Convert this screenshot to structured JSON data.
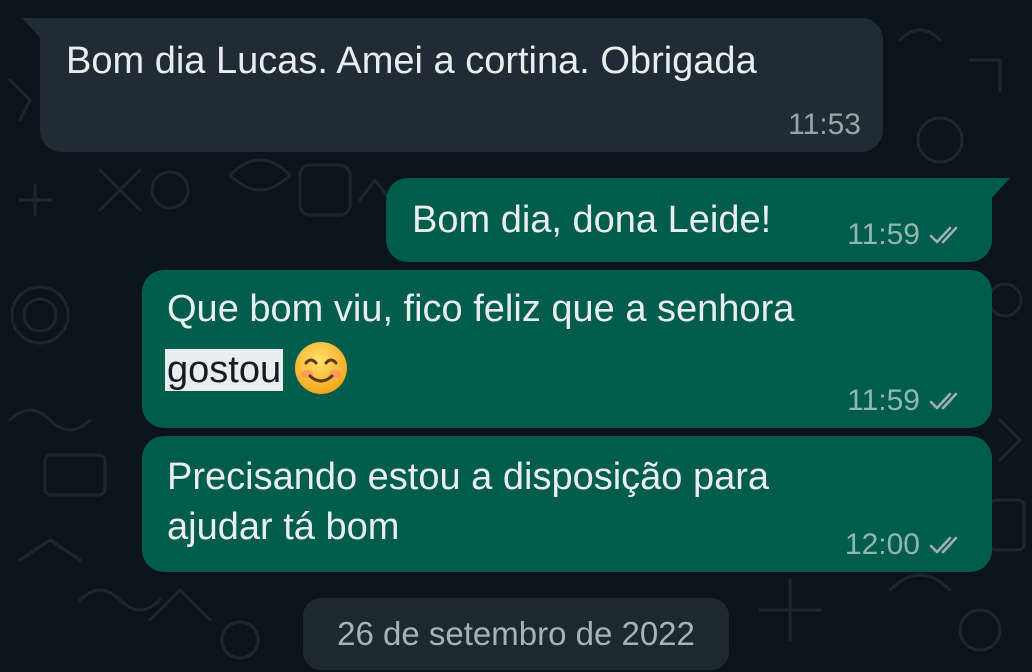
{
  "colors": {
    "background": "#0b141a",
    "incoming_bubble": "#202c33",
    "outgoing_bubble": "#005c4b",
    "text": "#e9edef",
    "meta_text": "#9fb0b7",
    "read_ticks": "#9fb0b7",
    "highlight": "#e9edef"
  },
  "messages": [
    {
      "direction": "incoming",
      "text": "Bom dia Lucas. Amei a cortina. Obrigada",
      "time": "11:53"
    },
    {
      "direction": "outgoing",
      "text": "Bom dia, dona Leide!",
      "time": "11:59",
      "status_icon": "double-check-icon"
    },
    {
      "direction": "outgoing",
      "line1": "Que bom viu, fico feliz que a senhora",
      "highlighted_word": "gostou",
      "emoji": "smiling-face-emoji",
      "time": "11:59",
      "status_icon": "double-check-icon"
    },
    {
      "direction": "outgoing",
      "line1": "Precisando estou a disposição para",
      "line2": "ajudar tá bom",
      "time": "12:00",
      "status_icon": "double-check-icon"
    }
  ],
  "date_separator": "26 de setembro de 2022"
}
